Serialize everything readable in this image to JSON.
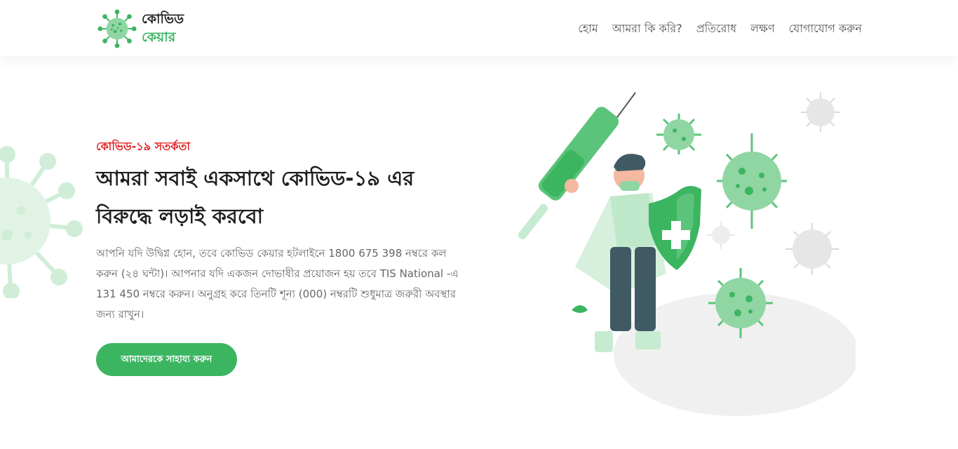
{
  "brand": {
    "line1": "কোভিড",
    "line2": "কেয়ার",
    "logo_icon": "virus-icon",
    "accent_color": "#3cb561"
  },
  "nav": {
    "items": [
      {
        "label": "হোম"
      },
      {
        "label": "আমরা কি করি?"
      },
      {
        "label": "প্রতিরোধ"
      },
      {
        "label": "লক্ষণ"
      },
      {
        "label": "যোগাযোগ করুন"
      }
    ]
  },
  "hero": {
    "eyebrow": "কোভিড-১৯ সতর্কতা",
    "eyebrow_color": "#e01b1b",
    "headline_line1": "আমরা সবাই একসাথে কোভিড-১৯ এর",
    "headline_line2": "বিরুদ্ধে লড়াই করবো",
    "description": "আপনি যদি উদ্বিগ্ন হোন, তবে কোভিড কেয়ার হটলাইনে 1800 675 398 নম্বরে কল করুন (২৪ ঘন্টা)। আপনার যদি একজন দোভাষীর প্রয়োজন হয় তবে TIS National -এ 131 450 নম্বরে করুন। অনুগ্রহ করে তিনটি শূন্য (000) নম্বরটি শুধুমাত্র জরুরী অবস্থার জন্য রাখুন।",
    "cta_label": "আমাদেরকে সাহায্য করুন",
    "illustration": "doctor-with-syringe-and-shield-illustration"
  }
}
